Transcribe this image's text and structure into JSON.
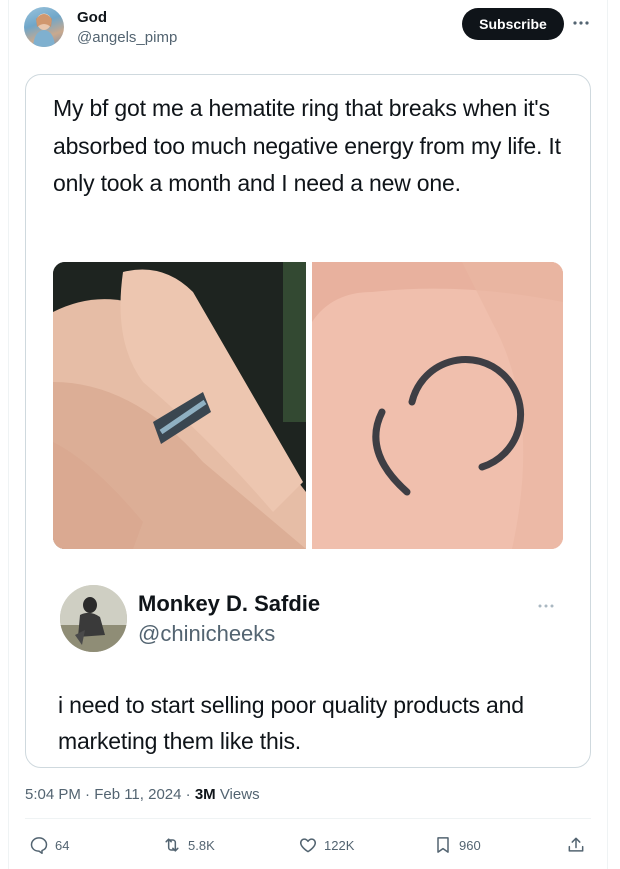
{
  "author": {
    "display_name": "God",
    "handle": "@angels_pimp"
  },
  "header": {
    "subscribe_label": "Subscribe",
    "more_icon": "more-horizontal-icon"
  },
  "post": {
    "text": "My bf got me a hematite ring that breaks when it's absorbed too much negative energy from my life. It only took a month and I need a new one."
  },
  "quoted": {
    "display_name": "Monkey D. Safdie",
    "handle": "@chinicheeks",
    "more_icon": "more-horizontal-icon",
    "text": "i need to start selling poor quality products and marketing them like this."
  },
  "meta": {
    "timestamp": "5:04 PM · Feb 11, 2024 · ",
    "views_count": "3M",
    "views_label": " Views"
  },
  "actions": {
    "reply_count": "64",
    "retweet_count": "5.8K",
    "like_count": "122K",
    "bookmark_count": "960"
  },
  "colors": {
    "text": "#0f1419",
    "secondary": "#536471",
    "border": "#cfd9de",
    "button": "#0f1419"
  }
}
